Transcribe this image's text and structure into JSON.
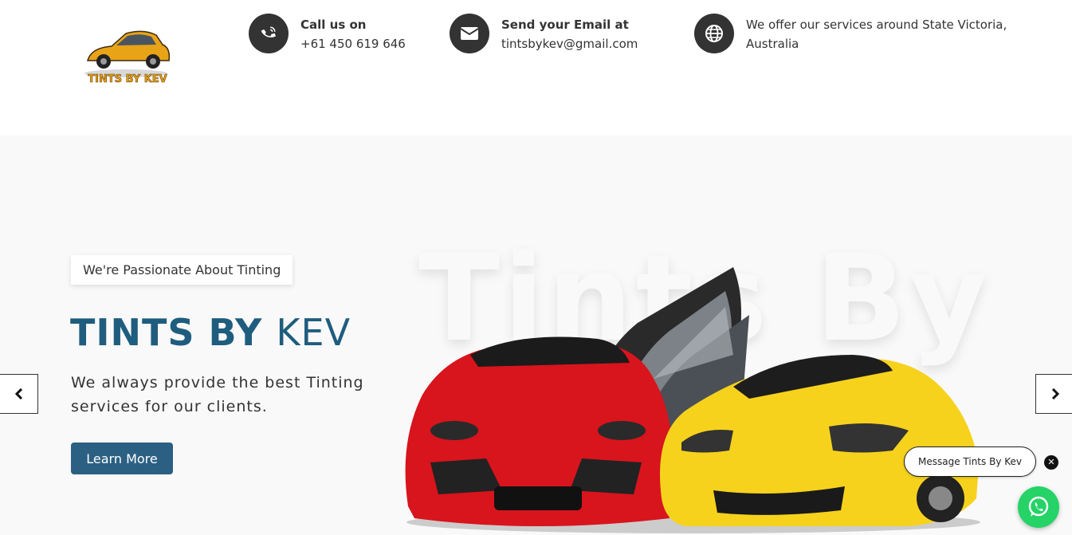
{
  "header": {
    "logo_text": "TINTS BY KEV",
    "contacts": [
      {
        "icon": "phone-icon",
        "title": "Call us on",
        "value": "+61 450 619 646"
      },
      {
        "icon": "envelope-icon",
        "title": "Send your Email at",
        "value": "tintsbykev@gmail.com"
      },
      {
        "icon": "globe-icon",
        "title": "",
        "value": "We offer our services around State Victoria, Australia"
      }
    ]
  },
  "hero": {
    "watermark": "Tints By",
    "tagline": "We're Passionate About Tinting",
    "title_bold": "TINTS BY",
    "title_light": "KEV",
    "subtitle": "We always provide the best Tinting services for our clients.",
    "cta_label": "Learn More",
    "prev_icon": "chevron-left-icon",
    "next_icon": "chevron-right-icon"
  },
  "chat": {
    "bubble_text": "Message Tints By Kev",
    "close_icon": "close-icon",
    "button_icon": "whatsapp-icon"
  },
  "colors": {
    "brand_blue": "#1f5d7e",
    "button_blue": "#2b6083",
    "icon_circle": "#333333",
    "whatsapp_green": "#25d366",
    "hero_bg": "#f9f9f9"
  }
}
